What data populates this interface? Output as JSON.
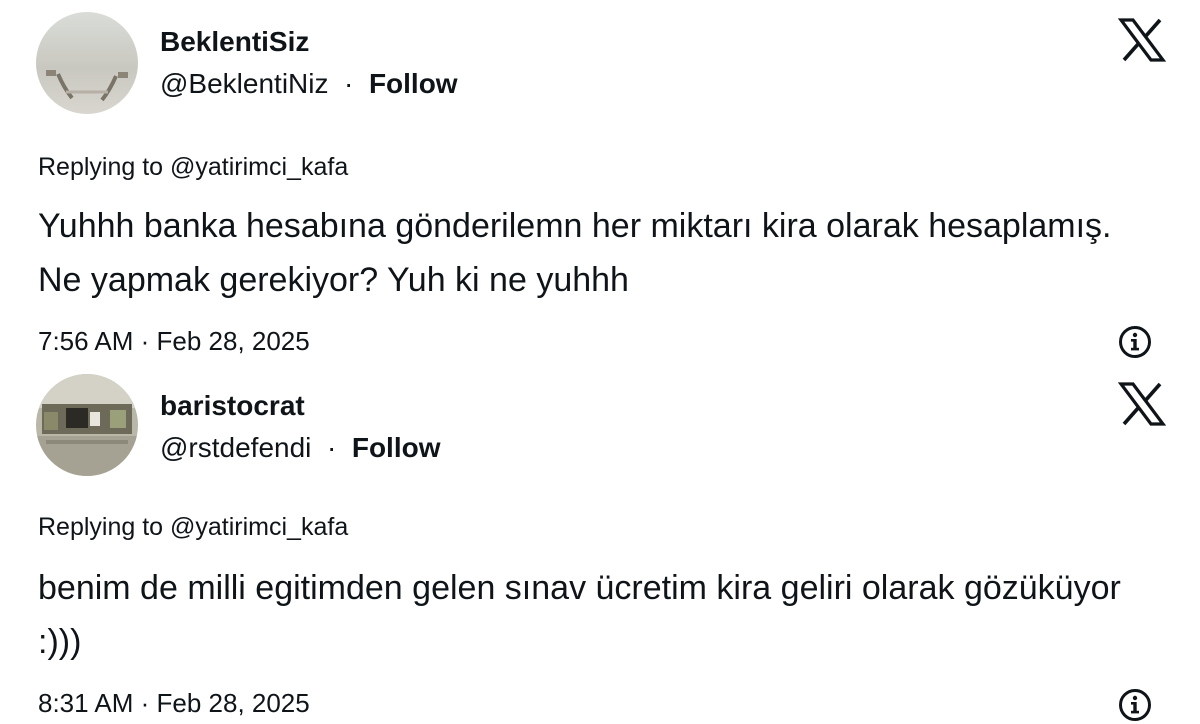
{
  "tweets": [
    {
      "display_name": "BeklentiSiz",
      "handle": "@BeklentiNiz",
      "separator": "·",
      "follow_label": "Follow",
      "replying_to": "Replying to @yatirimci_kafa",
      "text": "Yuhhh banka hesabına gönderilemn her miktarı kira olarak hesaplamış. Ne yapmak gerekiyor? Yuh ki ne yuhhh",
      "timestamp": "7:56 AM · Feb 28, 2025",
      "avatar_icon": "avatar-photo-hands",
      "platform_icon": "x-logo-icon",
      "info_icon": "info-icon"
    },
    {
      "display_name": "baristocrat",
      "handle": "@rstdefendi",
      "separator": "·",
      "follow_label": "Follow",
      "replying_to": "Replying to @yatirimci_kafa",
      "text": "benim de milli egitimden gelen sınav ücretim kira geliri olarak gözüküyor :)))",
      "timestamp": "8:31 AM · Feb 28, 2025",
      "avatar_icon": "avatar-photo-room",
      "platform_icon": "x-logo-icon",
      "info_icon": "info-icon"
    }
  ],
  "colors": {
    "text": "#0f1419",
    "background": "#ffffff"
  }
}
